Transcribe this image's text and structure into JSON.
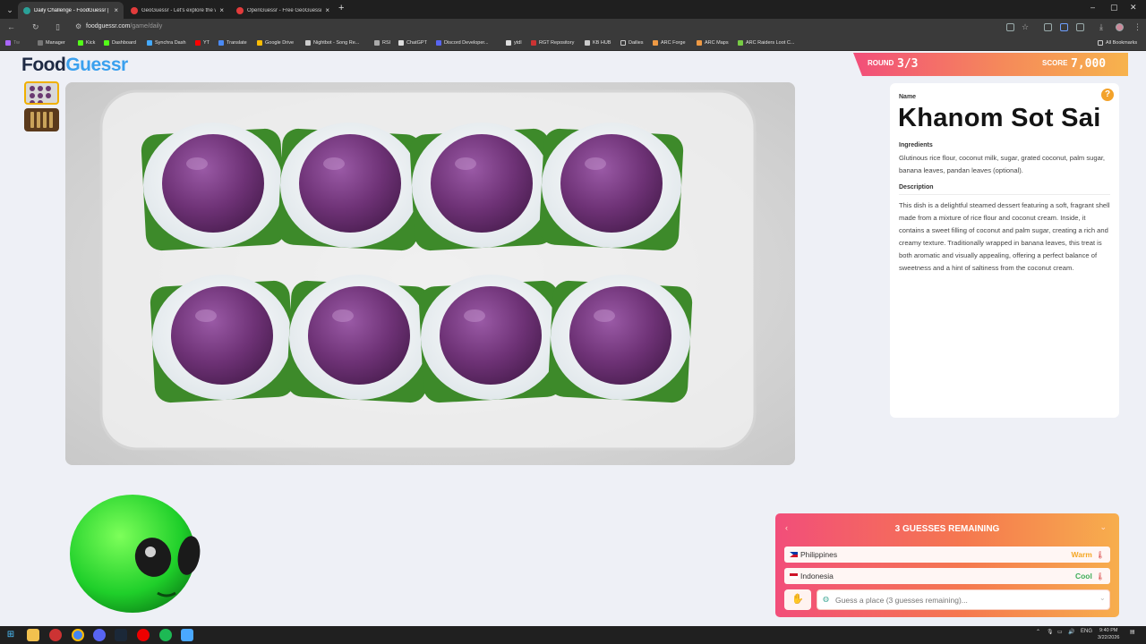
{
  "browser": {
    "tabs": [
      {
        "title": "Daily Challenge - FoodGuessr |",
        "active": true,
        "favicon_color": "#2aa198"
      },
      {
        "title": "GeoGuessr - Let's explore the w",
        "active": false,
        "favicon_color": "#e23b3b"
      },
      {
        "title": "OpenGuessr - Free GeoGuessr A",
        "active": false,
        "favicon_color": "#e23b3b"
      }
    ],
    "url_host": "foodguessr.com",
    "url_path": "/game/daily",
    "bookmarks": [
      "Manager",
      "Kick",
      "Dashboard",
      "Synchra Dash",
      "YT",
      "Translate",
      "Google Drive",
      "Nightbot - Song Re...",
      "RSI",
      "ChatGPT",
      "Discord Developer...",
      "ytdl",
      "RGT Repository",
      "KB HUB",
      "Dailies",
      "ARC Forge",
      "ARC Maps",
      "ARC Raiders Loot C..."
    ],
    "all_bookmarks": "All Bookmarks"
  },
  "app": {
    "logo_part1": "Food",
    "logo_part2": "Guessr"
  },
  "round": {
    "label": "ROUND",
    "value": "3/3"
  },
  "score": {
    "label": "SCORE",
    "value": "7,000"
  },
  "dish": {
    "name_label": "Name",
    "name": "Khanom Sot Sai",
    "ingredients_label": "Ingredients",
    "ingredients": "Glutinous rice flour, coconut milk, sugar, grated coconut, palm sugar, banana leaves, pandan leaves (optional).",
    "description_label": "Description",
    "description": "This dish is a delightful steamed dessert featuring a soft, fragrant shell made from a mixture of rice flour and coconut cream. Inside, it contains a sweet filling of coconut and palm sugar, creating a rich and creamy texture. Traditionally wrapped in banana leaves, this treat is both aromatic and visually appealing, offering a perfect balance of sweetness and a hint of saltiness from the coconut cream."
  },
  "guesses": {
    "header": "3 GUESSES REMAINING",
    "items": [
      {
        "country": "Philippines",
        "temp": "Warm",
        "temp_color": "#f5a623"
      },
      {
        "country": "Indonesia",
        "temp": "Cool",
        "temp_color": "#3fae5a"
      }
    ],
    "placeholder": "Guess a place (3 guesses remaining)..."
  },
  "taskbar": {
    "lang": "ENG",
    "time": "9:40 PM",
    "date": "3/22/2026"
  }
}
